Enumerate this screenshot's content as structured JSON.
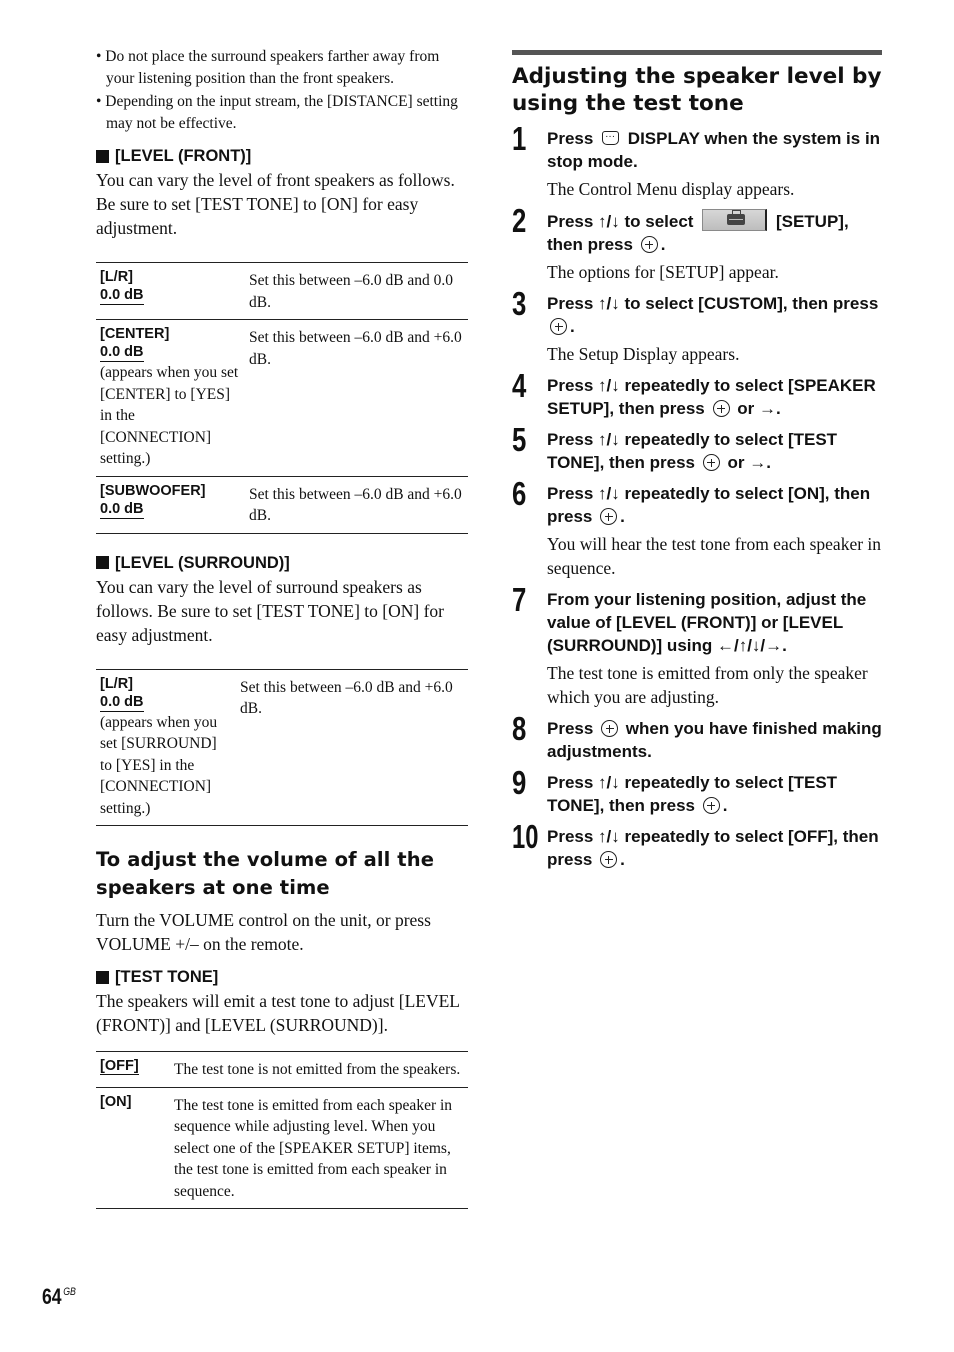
{
  "left": {
    "notes": [
      "• Do not place the surround speakers farther away from your listening position than the front speakers.",
      "• Depending on the input stream, the [DISTANCE] setting may not be effective."
    ],
    "level_front": {
      "heading": "[LEVEL (FRONT)]",
      "body": "You can vary the level of front speakers as follows. Be sure to set [TEST TONE] to [ON] for easy adjustment.",
      "rows": [
        {
          "name": "[L/R]",
          "default": "0.0 dB",
          "note": "",
          "desc": "Set this between –6.0 dB and 0.0 dB."
        },
        {
          "name": "[CENTER]",
          "default": "0.0 dB",
          "note": "(appears when you set [CENTER] to [YES] in the [CONNECTION] setting.)",
          "desc": "Set this between –6.0 dB and +6.0 dB."
        },
        {
          "name": "[SUBWOOFER]",
          "default": "0.0 dB",
          "note": "",
          "desc": "Set this between –6.0 dB and +6.0 dB."
        }
      ]
    },
    "level_surround": {
      "heading": "[LEVEL (SURROUND)]",
      "body": "You can vary the level of surround speakers as follows. Be sure to set [TEST TONE] to [ON] for easy adjustment.",
      "rows": [
        {
          "name": "[L/R]",
          "default": "0.0 dB",
          "note": "(appears when you set [SURROUND] to [YES] in the [CONNECTION] setting.)",
          "desc": "Set this between –6.0 dB and +6.0 dB."
        }
      ]
    },
    "volume_section": {
      "heading": "To adjust the volume of all the speakers at one time",
      "body": "Turn the VOLUME control on the unit, or press VOLUME +/– on the remote."
    },
    "test_tone": {
      "heading": "[TEST TONE]",
      "body": "The speakers will emit a test tone to adjust [LEVEL (FRONT)] and [LEVEL (SURROUND)].",
      "rows": [
        {
          "name": "[OFF]",
          "is_default": true,
          "desc": "The test tone is not emitted from the speakers."
        },
        {
          "name": "[ON]",
          "is_default": false,
          "desc": "The test tone is emitted from each speaker in sequence while adjusting level. When you select one of the [SPEAKER SETUP] items, the test tone is emitted from each speaker in sequence."
        }
      ]
    }
  },
  "right": {
    "heading": "Adjusting the speaker level by using the test tone",
    "steps": [
      {
        "num": "1",
        "pre": "Press",
        "icon": "display-icon",
        "post": "DISPLAY when the system is in stop mode.",
        "result": "The Control Menu display appears."
      },
      {
        "num": "2",
        "pre": "Press ↑/↓ to select",
        "icon": "setup-icon",
        "post": "[SETUP], then press",
        "icon2": "enter-icon",
        "post2": ".",
        "result": "The options for [SETUP] appear."
      },
      {
        "num": "3",
        "pre": "Press ↑/↓ to select [CUSTOM], then press",
        "icon": "enter-icon",
        "post": ".",
        "result": "The Setup Display appears."
      },
      {
        "num": "4",
        "pre": "Press ↑/↓ repeatedly to select [SPEAKER SETUP], then press",
        "icon": "enter-icon",
        "post": "or →.",
        "result": ""
      },
      {
        "num": "5",
        "pre": "Press ↑/↓ repeatedly to select [TEST TONE], then press",
        "icon": "enter-icon",
        "post": "or →.",
        "result": ""
      },
      {
        "num": "6",
        "pre": "Press ↑/↓ repeatedly to select [ON], then press",
        "icon": "enter-icon",
        "post": ".",
        "result": "You will hear the test tone from each speaker in sequence."
      },
      {
        "num": "7",
        "pre": "From your listening position, adjust the value of [LEVEL (FRONT)] or [LEVEL (SURROUND)] using ←/↑/↓/→.",
        "icon": "",
        "post": "",
        "result": "The test tone is emitted from only the speaker which you are adjusting."
      },
      {
        "num": "8",
        "pre": "Press",
        "icon": "enter-icon",
        "post": "when you have finished making adjustments.",
        "result": ""
      },
      {
        "num": "9",
        "pre": "Press ↑/↓ repeatedly to select [TEST TONE], then press",
        "icon": "enter-icon",
        "post": ".",
        "result": ""
      },
      {
        "num": "10",
        "pre": "Press ↑/↓ repeatedly to select [OFF], then press",
        "icon": "enter-icon",
        "post": ".",
        "result": ""
      }
    ]
  },
  "footer": {
    "page_number": "64",
    "region_code": "GB"
  }
}
